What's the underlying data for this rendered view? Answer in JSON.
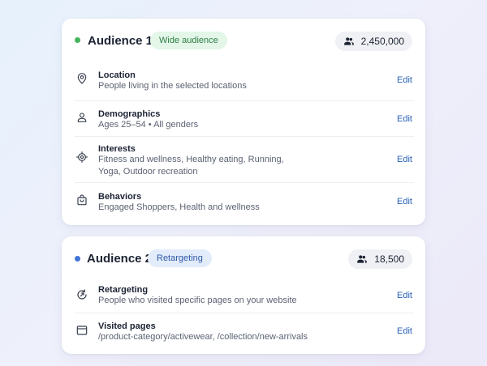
{
  "audiences": [
    {
      "title": "Audience 1",
      "status_color": "#43b35c",
      "tag": "Wide audience",
      "count": "2,450,000",
      "rows": [
        {
          "icon": "location-pin-icon",
          "title": "Location",
          "desc": "People living in the selected locations",
          "edit": "Edit"
        },
        {
          "icon": "person-icon",
          "title": "Demographics",
          "desc": "Ages 25–54 • All genders",
          "edit": "Edit"
        },
        {
          "icon": "target-icon",
          "title": "Interests",
          "desc": "Fitness and wellness, Healthy eating, Running, Yoga, Outdoor recreation",
          "edit": "Edit"
        },
        {
          "icon": "shopping-bag-icon",
          "title": "Behaviors",
          "desc": "Engaged Shoppers, Health and wellness",
          "edit": "Edit"
        }
      ]
    },
    {
      "title": "Audience 2",
      "status_color": "#3f73d6",
      "tag": "Retargeting",
      "count": "18,500",
      "rows": [
        {
          "icon": "retarget-refresh-icon",
          "title": "Retargeting",
          "desc": "People who visited specific pages on your website",
          "edit": "Edit"
        },
        {
          "icon": "browser-window-icon",
          "title": "Visited pages",
          "desc": "/product-category/activewear, /collection/new-arrivals",
          "edit": "Edit"
        }
      ]
    }
  ]
}
